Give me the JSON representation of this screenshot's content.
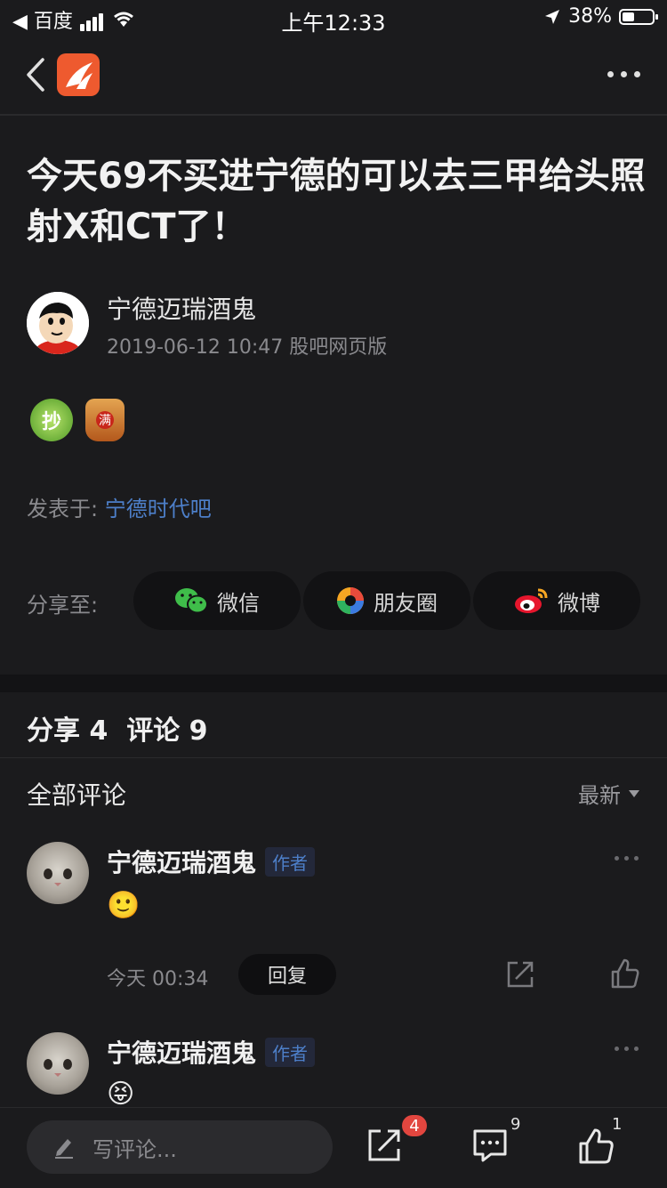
{
  "status_bar": {
    "carrier": "◀ 百度",
    "time": "上午12:33",
    "battery": "38%"
  },
  "post": {
    "title": "今天69不买进宁德的可以去三甲给头照射X和CT了！",
    "author": "宁德迈瑞酒鬼",
    "meta": "2019-06-12 10:47 股吧网页版",
    "sticker1_text": "抄",
    "sticker2_text": "满",
    "posted_label": "发表于:",
    "posted_forum": "宁德时代吧"
  },
  "share": {
    "label": "分享至:",
    "buttons": [
      {
        "label": "微信",
        "icon": "wechat-icon"
      },
      {
        "label": "朋友圈",
        "icon": "moments-icon"
      },
      {
        "label": "微博",
        "icon": "weibo-icon"
      }
    ]
  },
  "counts": {
    "text": "分享 4  评论 9"
  },
  "comments_section": {
    "title": "全部评论",
    "sort": "最新",
    "comments": [
      {
        "author": "宁德迈瑞酒鬼",
        "badge": "作者",
        "emoji": "🙂",
        "time": "今天 00:34",
        "reply": "回复"
      },
      {
        "author": "宁德迈瑞酒鬼",
        "badge": "作者",
        "emoji": "😝"
      }
    ]
  },
  "bottom_bar": {
    "placeholder": "写评论...",
    "share_count": "4",
    "comment_count": "9",
    "like_count": "1"
  },
  "colors": {
    "background": "#1b1b1d",
    "link": "#4d7fc9",
    "badge_red": "#e2463f",
    "app_logo": "#ee5a2f"
  }
}
